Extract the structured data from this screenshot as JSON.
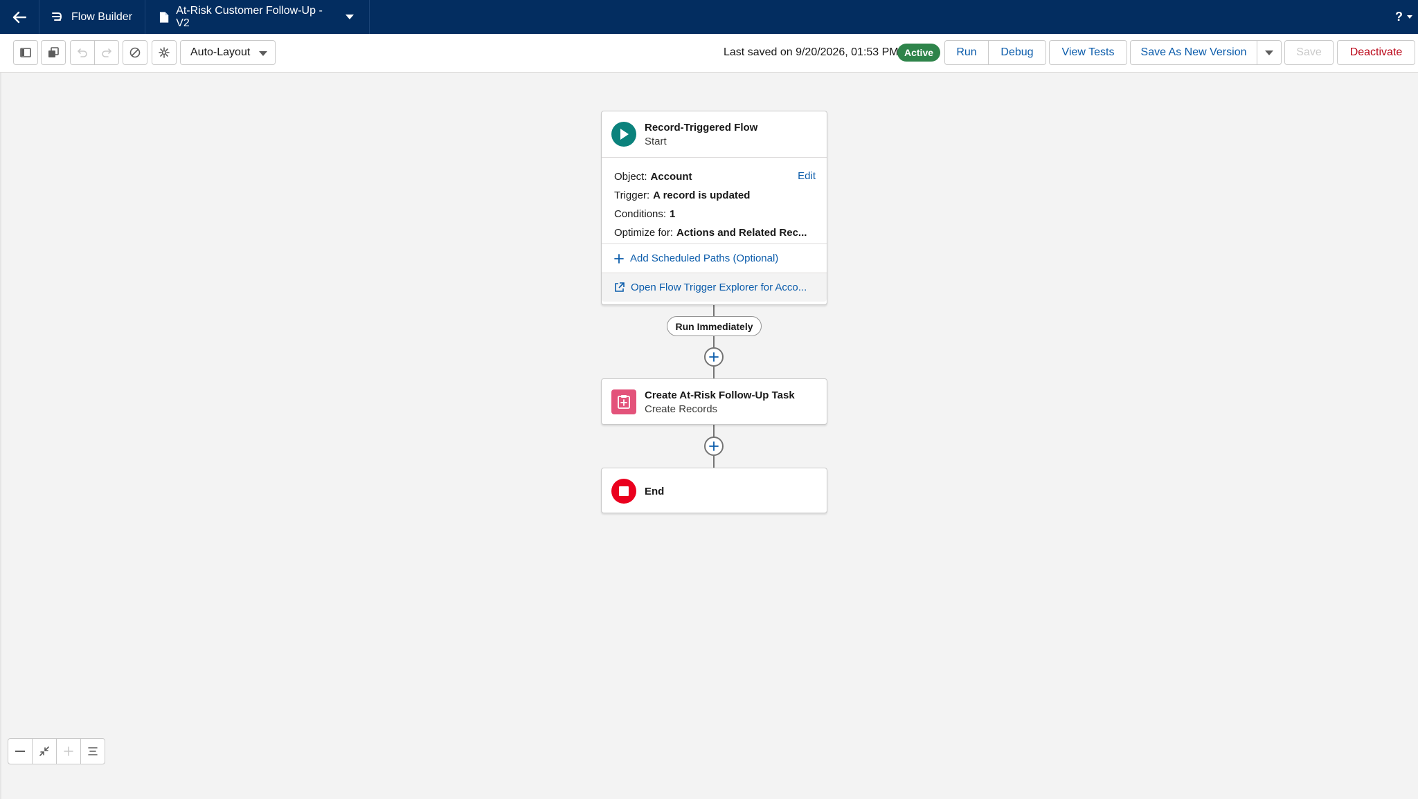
{
  "topbar": {
    "app_name": "Flow Builder",
    "flow_name": "At-Risk Customer Follow-Up - V2",
    "help_label": "?"
  },
  "toolbar": {
    "layout_mode": "Auto-Layout",
    "last_saved": "Last saved on 9/20/2026, 01:53 PM",
    "status_badge": "Active",
    "run_label": "Run",
    "debug_label": "Debug",
    "view_tests_label": "View Tests",
    "save_new_version_label": "Save As New Version",
    "save_label": "Save",
    "deactivate_label": "Deactivate"
  },
  "start_node": {
    "title": "Record-Triggered Flow",
    "subtitle": "Start",
    "edit_label": "Edit",
    "object_label": "Object:",
    "object_value": "Account",
    "trigger_label": "Trigger:",
    "trigger_value": "A record is updated",
    "conditions_label": "Conditions:",
    "conditions_value": "1",
    "optimize_label": "Optimize for:",
    "optimize_value": "Actions and Related Rec...",
    "scheduled_paths_link": "Add Scheduled Paths (Optional)",
    "trigger_explorer_link": "Open Flow Trigger Explorer for Acco..."
  },
  "path_label": "Run Immediately",
  "create_node": {
    "title": "Create At-Risk Follow-Up Task",
    "subtitle": "Create Records"
  },
  "end_node": {
    "title": "End"
  },
  "colors": {
    "navy": "#032d60",
    "link_blue": "#0b5cab",
    "active_green": "#2e844a",
    "start_teal": "#0b827c",
    "create_pink": "#e3527a",
    "end_red": "#ea001e",
    "deactivate_red": "#ba0517"
  }
}
